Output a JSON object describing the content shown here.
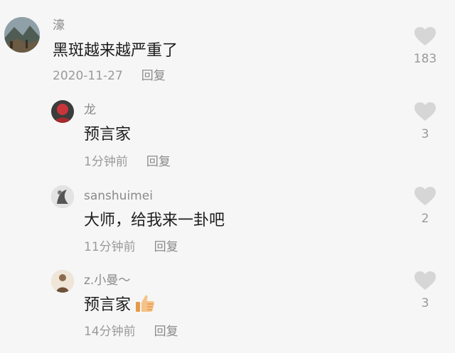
{
  "comments": [
    {
      "username": "濠",
      "text": "黑斑越来越严重了",
      "time": "2020-11-27",
      "reply_label": "回复",
      "likes": "183",
      "avatar_icon": "mountain-landscape-avatar"
    },
    {
      "username": "龙",
      "text": "预言家",
      "time": "1分钟前",
      "reply_label": "回复",
      "likes": "3",
      "avatar_icon": "red-figure-avatar"
    },
    {
      "username": "sanshuimei",
      "text": "大师，给我来一卦吧",
      "time": "11分钟前",
      "reply_label": "回复",
      "likes": "2",
      "avatar_icon": "ink-sketch-avatar"
    },
    {
      "username": "z.小曼～",
      "text": "预言家",
      "emoji": "thumbs-up",
      "time": "14分钟前",
      "reply_label": "回复",
      "likes": "3",
      "avatar_icon": "beige-figure-avatar"
    }
  ],
  "colors": {
    "background": "#f6f6f6",
    "username": "#8a8a8a",
    "text": "#1e1e1e",
    "meta": "#9a9a9a",
    "heart": "#d6d6d6"
  }
}
